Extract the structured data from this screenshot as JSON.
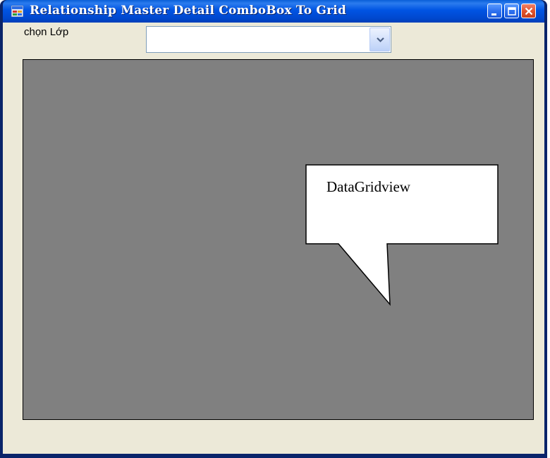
{
  "window": {
    "title": "Relationship Master Detail ComboBox To Grid"
  },
  "form": {
    "combo_label": "chọn Lớp",
    "combo_value": ""
  },
  "grid": {
    "callout_text": "DataGridview"
  },
  "colors": {
    "titlebar": "#0054e3",
    "client_bg": "#ece9d8",
    "grid_bg": "#808080"
  },
  "icons": {
    "app": "app-icon",
    "minimize": "minimize-icon",
    "maximize": "maximize-icon",
    "close": "close-icon",
    "dropdown": "chevron-down-icon"
  }
}
